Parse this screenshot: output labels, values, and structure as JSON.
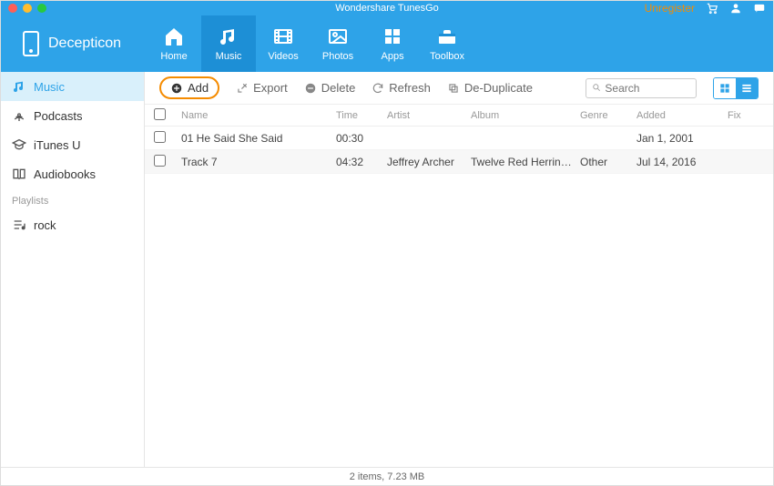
{
  "app": {
    "title": "Wondershare TunesGo",
    "unregister": "Unregister"
  },
  "device": {
    "name": "Decepticon"
  },
  "tabs": [
    {
      "label": "Home",
      "name": "home"
    },
    {
      "label": "Music",
      "name": "music"
    },
    {
      "label": "Videos",
      "name": "videos"
    },
    {
      "label": "Photos",
      "name": "photos"
    },
    {
      "label": "Apps",
      "name": "apps"
    },
    {
      "label": "Toolbox",
      "name": "toolbox"
    }
  ],
  "sidebar": {
    "items": [
      {
        "label": "Music"
      },
      {
        "label": "Podcasts"
      },
      {
        "label": "iTunes U"
      },
      {
        "label": "Audiobooks"
      }
    ],
    "section": "Playlists",
    "playlists": [
      {
        "label": "rock"
      }
    ]
  },
  "toolbar": {
    "add": "Add",
    "export": "Export",
    "delete": "Delete",
    "refresh": "Refresh",
    "dedup": "De-Duplicate",
    "search_placeholder": "Search"
  },
  "columns": {
    "name": "Name",
    "time": "Time",
    "artist": "Artist",
    "album": "Album",
    "genre": "Genre",
    "added": "Added",
    "fix": "Fix"
  },
  "rows": [
    {
      "name": "01 He Said She Said",
      "time": "00:30",
      "artist": "",
      "album": "",
      "genre": "",
      "added": "Jan 1, 2001"
    },
    {
      "name": "Track 7",
      "time": "04:32",
      "artist": "Jeffrey Archer",
      "album": "Twelve Red Herrin…",
      "genre": "Other",
      "added": "Jul 14, 2016"
    }
  ],
  "status": "2 items, 7.23 MB"
}
